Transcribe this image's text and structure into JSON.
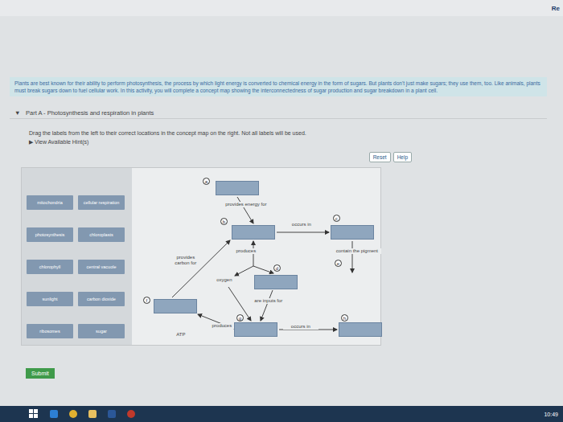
{
  "browser_tab": {
    "label": "Re"
  },
  "intro": "Plants are best known for their ability to perform photosynthesis, the process by which light energy is converted to chemical energy in the form of sugars. But plants don't just make sugars; they use them, too. Like animals, plants must break sugars down to fuel cellular work. In this activity, you will complete a concept map showing the interconnectedness of sugar production and sugar breakdown in a plant cell.",
  "part": {
    "toggle": "▼",
    "title": "Part A - Photosynthesis and respiration in plants",
    "expanded": true
  },
  "instruction": "Drag the labels from the left to their correct locations in the concept map on the right. Not all labels will be used.",
  "hint": {
    "toggle": "▶",
    "label": "View Available Hint(s)"
  },
  "buttons": [
    "Reset",
    "Help"
  ],
  "labels": [
    "mitochondria",
    "cellular respiration",
    "photosynthesis",
    "chloroplasts",
    "chlorophyll",
    "central vacuole",
    "sunlight",
    "carbon dioxide",
    "ribosomes",
    "sugar"
  ],
  "targets": [
    {
      "marker": "a",
      "kind": "box"
    },
    {
      "marker": "b",
      "kind": "box"
    },
    {
      "marker": "c",
      "kind": "box"
    },
    {
      "marker": "d",
      "kind": "box"
    },
    {
      "marker": "e",
      "kind": "marker"
    },
    {
      "marker": "f",
      "kind": "box"
    },
    {
      "marker": "g",
      "kind": "box"
    },
    {
      "marker": "h",
      "kind": "box"
    }
  ],
  "link_labels": [
    "provides energy for",
    "occurs in",
    "produces",
    "contain the pigment",
    "provides carbon for",
    "oxygen",
    "are inputs for",
    "produces",
    "occurs in",
    "ATP"
  ],
  "submit": "Submit",
  "taskbar": {
    "clock": "10:49"
  }
}
